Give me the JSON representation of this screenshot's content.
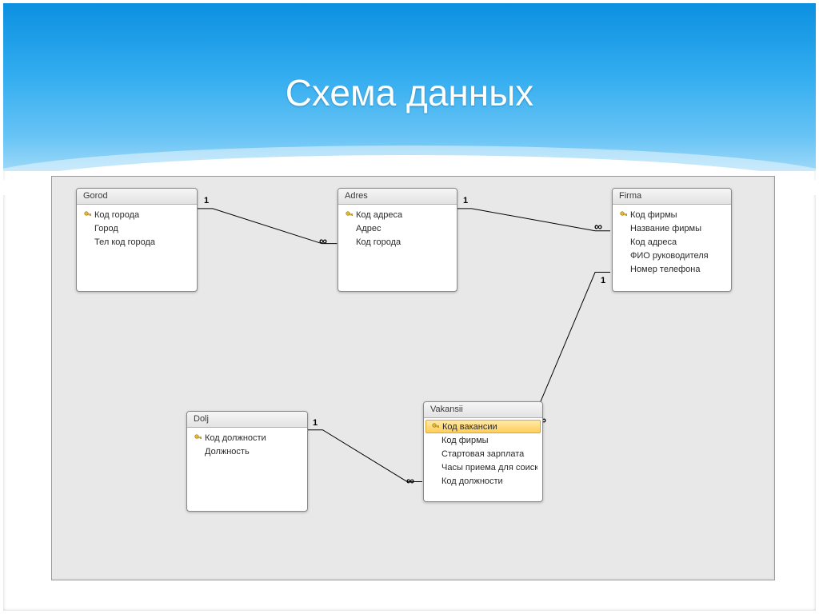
{
  "slide": {
    "title": "Схема данных"
  },
  "tables": {
    "gorod": {
      "title": "Gorod",
      "fields": [
        {
          "name": "Код города",
          "pk": true
        },
        {
          "name": "Город",
          "pk": false
        },
        {
          "name": "Тел код города",
          "pk": false
        }
      ]
    },
    "adres": {
      "title": "Adres",
      "fields": [
        {
          "name": "Код адреса",
          "pk": true
        },
        {
          "name": "Адрес",
          "pk": false
        },
        {
          "name": "Код города",
          "pk": false
        }
      ]
    },
    "firma": {
      "title": "Firma",
      "fields": [
        {
          "name": "Код фирмы",
          "pk": true
        },
        {
          "name": "Название фирмы",
          "pk": false
        },
        {
          "name": "Код адреса",
          "pk": false
        },
        {
          "name": "ФИО руководителя",
          "pk": false
        },
        {
          "name": "Номер телефона",
          "pk": false
        }
      ]
    },
    "dolj": {
      "title": "Dolj",
      "fields": [
        {
          "name": "Код должности",
          "pk": true
        },
        {
          "name": "Должность",
          "pk": false
        }
      ]
    },
    "vakansii": {
      "title": "Vakansii",
      "fields": [
        {
          "name": "Код вакансии",
          "pk": true,
          "selected": true
        },
        {
          "name": "Код фирмы",
          "pk": false
        },
        {
          "name": "Стартовая зарплата",
          "pk": false
        },
        {
          "name": "Часы приема для соискателей",
          "pk": false
        },
        {
          "name": "Код должности",
          "pk": false
        }
      ]
    }
  },
  "relationships": [
    {
      "from": "gorod",
      "to": "adres",
      "from_card": "1",
      "to_card": "∞"
    },
    {
      "from": "adres",
      "to": "firma",
      "from_card": "1",
      "to_card": "∞"
    },
    {
      "from": "firma",
      "to": "vakansii",
      "from_card": "1",
      "to_card": "∞"
    },
    {
      "from": "dolj",
      "to": "vakansii",
      "from_card": "1",
      "to_card": "∞"
    }
  ],
  "symbols": {
    "one": "1",
    "many": "∞"
  }
}
